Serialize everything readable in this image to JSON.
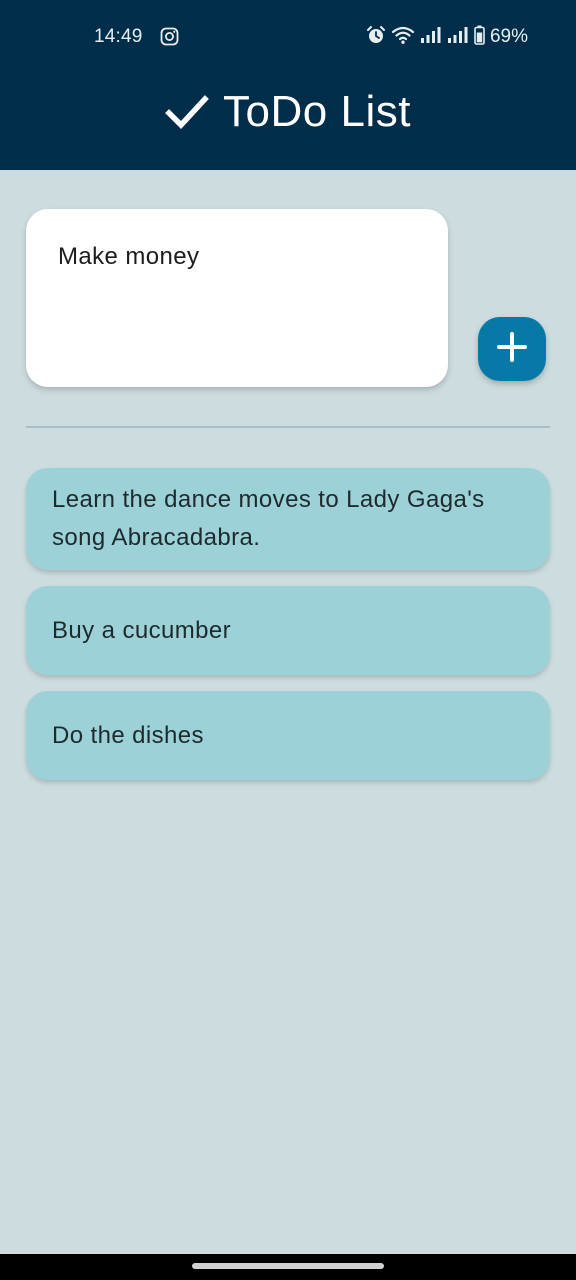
{
  "status_bar": {
    "time": "14:49",
    "battery_percent": "69%",
    "icons": [
      "instagram-icon",
      "alarm-icon",
      "wifi-icon",
      "signal-icon",
      "signal-icon",
      "battery-icon"
    ]
  },
  "header": {
    "title": "ToDo List",
    "icon": "checkmark-icon"
  },
  "new_task": {
    "value": "Make money",
    "add_button_icon": "plus-icon"
  },
  "todos": [
    {
      "text": "Learn the dance moves to Lady Gaga's song Abracadabra."
    },
    {
      "text": "Buy a cucumber"
    },
    {
      "text": "Do the dishes"
    }
  ],
  "colors": {
    "header_bg": "#002E4A",
    "page_bg": "#CCDCDF",
    "item_bg": "#9CD2D7",
    "accent": "#0779A6"
  }
}
